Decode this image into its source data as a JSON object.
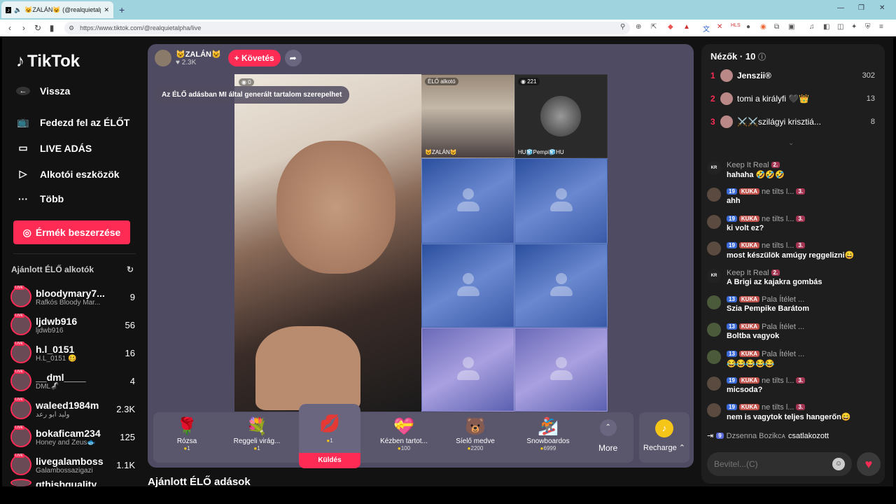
{
  "browser": {
    "tab_title": "😺ZALÁN😺 (@realquietalpha) | TikTok",
    "url": "https://www.tiktok.com/@realquietalpha/live",
    "new_tab": "+",
    "ext_hls": "HLS"
  },
  "sidebar": {
    "logo": "TikTok",
    "back": "Vissza",
    "nav": [
      {
        "label": "Fedezd fel az ÉLŐT"
      },
      {
        "label": "LIVE ADÁS"
      },
      {
        "label": "Alkotói eszközök"
      },
      {
        "label": "Több"
      }
    ],
    "coins_button": "Érmék beszerzése",
    "rec_title": "Ajánlott ÉLŐ alkotók",
    "live_tag": "LIVE",
    "creators": [
      {
        "name": "bloodymary7...",
        "sub": "Rafkós Bloody Mar...",
        "count": "9"
      },
      {
        "name": "ljdwb916",
        "sub": "ljdwb916",
        "count": "56"
      },
      {
        "name": "h.l_0151",
        "sub": "H.L_0151 🥴",
        "count": "16"
      },
      {
        "name": "__dml____",
        "sub": "DML🦨",
        "count": "4"
      },
      {
        "name": "waleed1984m",
        "sub": "وليد ابو رعد",
        "count": "2.3K"
      },
      {
        "name": "bokaficam234",
        "sub": "Honey and Zeus🐟",
        "count": "125"
      },
      {
        "name": "livegalamboss",
        "sub": "Galambossazigazi",
        "count": "1.1K"
      },
      {
        "name": "gthisbquality",
        "sub": "",
        "count": ""
      }
    ]
  },
  "stage": {
    "host_name": "😺ZALÁN😺",
    "host_likes": "2.3K",
    "follow": "+ Követés",
    "ai_notice": "Az ÉLŐ adásban MI által generált tartalom szerepelhet",
    "main_viewers": "0",
    "guest1_tag": "ÉLŐ alkotó",
    "guest1_name": "😺ZALÁN😺",
    "guest2_viewers": "221",
    "guest2_name": "HU🧊Pempi🧊HU",
    "gifts": [
      {
        "name": "Rózsa",
        "price": "1",
        "icon": "🌹"
      },
      {
        "name": "Reggeli virág...",
        "price": "1",
        "icon": "💐"
      },
      {
        "name": "Kézben tartot...",
        "price": "100",
        "icon": "💝"
      },
      {
        "name": "Síelő medve",
        "price": "2200",
        "icon": "🐻"
      },
      {
        "name": "Snowboardos",
        "price": "6999",
        "icon": "🏂"
      }
    ],
    "selected_gift": {
      "icon": "💋",
      "price": "1",
      "send": "Küldés"
    },
    "more": "More",
    "recharge": "Recharge",
    "below_title": "Ajánlott ÉLŐ adások"
  },
  "chat": {
    "viewers_title": "Nézők · 10",
    "top_viewers": [
      {
        "rank": "1",
        "name": "Jenszii®",
        "count": "302"
      },
      {
        "rank": "2",
        "name": "tomi a királyfi 🖤👑",
        "count": "13"
      },
      {
        "rank": "3",
        "name": "⚔️⚔️szilágyi krisztiá...",
        "count": "8"
      }
    ],
    "messages": [
      {
        "user": "Keep It Real",
        "level": "",
        "fan": "2.",
        "extra": "",
        "text": "hahaha 🤣🤣🤣"
      },
      {
        "user": "ne tilts l...",
        "level": "19",
        "fan": "3.",
        "extra": "KUKA",
        "text": "ahh"
      },
      {
        "user": "ne tilts l...",
        "level": "19",
        "fan": "3.",
        "extra": "KUKA",
        "text": "ki volt ez?"
      },
      {
        "user": "ne tilts l...",
        "level": "19",
        "fan": "3.",
        "extra": "KUKA",
        "text": "most készülök amúgy reggelizni😄"
      },
      {
        "user": "Keep It Real",
        "level": "",
        "fan": "2.",
        "extra": "",
        "text": "A Brigi az kajakra gombás"
      },
      {
        "user": "Pala Ítélet ...",
        "level": "13",
        "fan": "",
        "extra": "KUKA",
        "text": "Szia Pempike Barátom"
      },
      {
        "user": "Pala Ítélet ...",
        "level": "13",
        "fan": "",
        "extra": "KUKA",
        "text": "Boltba vagyok"
      },
      {
        "user": "Pala Ítélet ...",
        "level": "13",
        "fan": "",
        "extra": "KUKA",
        "text": "😂😂😂😂😂"
      },
      {
        "user": "ne tilts l...",
        "level": "19",
        "fan": "3.",
        "extra": "KUKA",
        "text": "micsoda?"
      },
      {
        "user": "ne tilts l...",
        "level": "19",
        "fan": "3.",
        "extra": "KUKA",
        "text": "nem is vagytok teljes hangerőn😄"
      }
    ],
    "joined": {
      "level": "9",
      "user": "Dzsenna Bozikcᴀ",
      "action": "csatlakozott"
    },
    "input_placeholder": "Bevitel...(C)"
  },
  "colors": {
    "accent": "#fe2c55",
    "stage": "#4f4b62",
    "panel": "#1e1e1e"
  }
}
